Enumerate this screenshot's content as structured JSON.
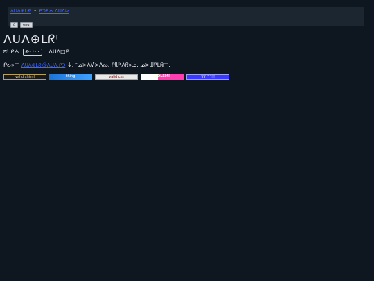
{
  "topbar": {
    "links": [
      "Ʌᑌᐱ⊕ᒪᖇᑊ",
      "ᑭᑐᑭᗅ ᐱᑌᐱᐅ"
    ],
    "separator": "*",
    "buttons": [
      "ū",
      "eng"
    ]
  },
  "title": "ᐱᑌᐱ⊕ᒪᖇᑊ",
  "line1": {
    "prefix": "ठ! ᑭᗅ",
    "code": "ᖇ·· ᐩ· ·",
    "suffix": ". ᐱᑌᐱ□ᑭ"
  },
  "line2": {
    "prefix": "ᑭ౿»□",
    "link": "ᐱᑌᐱ⊕ᒪᖇᑊ@ᐱᑌᐱ.ᑭᑐ",
    "suffix": " ↓. ᐨᓄ>ᐱV>ᐱᔓ. ᑭᗯᕽᐱᖇ»ᓄ. ᓄ>ᗯᑭᒪᖇ□."
  },
  "badges": [
    {
      "label": "valid xhtml",
      "icon": "xhtml-badge-icon"
    },
    {
      "label": "thing",
      "icon": "thing-badge-icon"
    },
    {
      "label": "valid css",
      "icon": "css-badge-icon"
    },
    {
      "label": "GOLEM!",
      "icon": "golem-badge-icon"
    },
    {
      "label": "ʻiʻiʻ ʼʼʻ!!!",
      "icon": "extra-badge-icon"
    }
  ]
}
